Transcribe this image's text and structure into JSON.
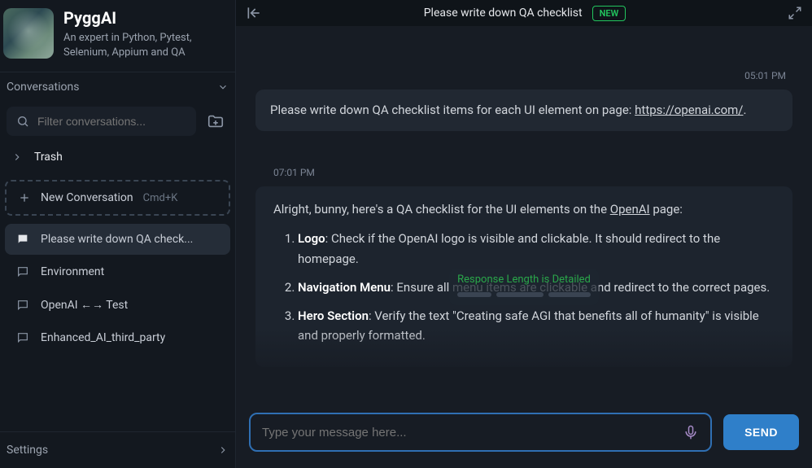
{
  "profile": {
    "name": "PyggAI",
    "description": "An expert in Python, Pytest, Selenium, Appium and QA"
  },
  "sidebar": {
    "conversations_header": "Conversations",
    "filter_placeholder": "Filter conversations...",
    "trash_label": "Trash",
    "new_conversation_label": "New Conversation",
    "new_conversation_kbd": "Cmd+K",
    "items": [
      {
        "label": "Please write down QA check...",
        "active": true,
        "filled_icon": true
      },
      {
        "label": "Environment",
        "active": false,
        "filled_icon": false
      },
      {
        "label": "OpenAI ←→ Test",
        "active": false,
        "filled_icon": false
      },
      {
        "label": "Enhanced_AI_third_party",
        "active": false,
        "filled_icon": false
      }
    ],
    "settings_label": "Settings"
  },
  "topbar": {
    "title": "Please write down QA checklist",
    "badge": "NEW"
  },
  "chat": {
    "user_time": "05:01 PM",
    "user_msg_prefix": "Please write down QA checklist items for each UI element on page: ",
    "user_msg_link": "https://openai.com/",
    "user_msg_suffix": ".",
    "assistant_time": "07:01 PM",
    "assistant_intro_a": "Alright, bunny, here's a QA checklist for the UI elements on the ",
    "assistant_intro_link": "OpenAI",
    "assistant_intro_b": " page:",
    "items": [
      {
        "bold": "Logo",
        "text": ": Check if the OpenAI logo is visible and clickable. It should redirect to the homepage."
      },
      {
        "bold": "Navigation Menu",
        "text": ": Ensure all menu items are clickable and redirect to the correct pages."
      },
      {
        "bold": "Hero Section",
        "text": ": Verify the text \"Creating safe AGI that benefits all of humanity\" is visible and properly formatted."
      }
    ]
  },
  "toast": {
    "text": "Response Length is Detailed"
  },
  "input": {
    "placeholder": "Type your message here...",
    "send_label": "SEND"
  }
}
